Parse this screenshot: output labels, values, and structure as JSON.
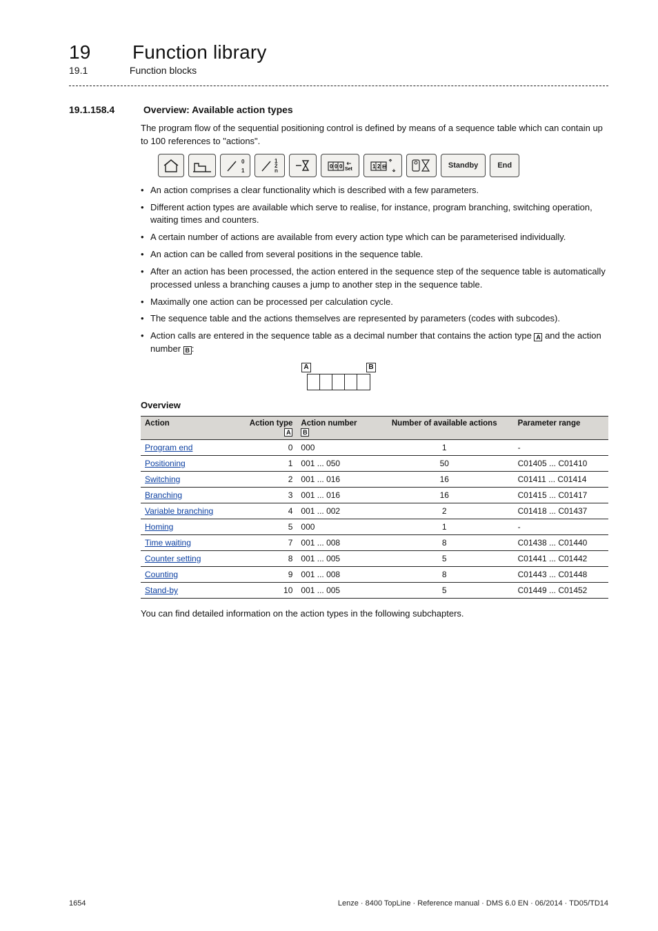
{
  "header": {
    "chapter_number": "19",
    "chapter_title": "Function library",
    "sub_number": "19.1",
    "sub_title": "Function blocks"
  },
  "section": {
    "number": "19.1.158.4",
    "title": "Overview: Available action types",
    "intro": "The program flow of the sequential positioning control is defined by means of a sequence table which can contain up to 100 references to \"actions\".",
    "iconbar_labels": {
      "standby": "Standby",
      "end": "End"
    },
    "bullets": [
      "An action comprises a clear functionality which is described with a few parameters.",
      "Different action types are available which serve to realise, for instance, program branching, switching operation, waiting times and counters.",
      "A certain number of actions are available from every action type which can be parameterised individually.",
      "An action can be called from several positions in the sequence table.",
      "After an action has been processed, the action entered in the sequence step of the sequence table is automatically processed unless a branching causes a jump to another step in the sequence table.",
      "Maximally one action can be processed per calculation cycle.",
      "The sequence table and the actions themselves are represented by parameters (codes with subcodes).",
      "Action calls are entered in the sequence table as a decimal number that contains the action type {A} and the action number {B}:"
    ],
    "ab_letters": {
      "a": "A",
      "b": "B"
    },
    "overview_label": "Overview",
    "table": {
      "headers": {
        "action": "Action",
        "type": "Action type",
        "type_sub": "A",
        "number": "Action number",
        "number_sub": "B",
        "available": "Number of available actions",
        "range": "Parameter range"
      },
      "rows": [
        {
          "action": "Program end",
          "type": "0",
          "number": "000",
          "avail": "1",
          "range": "-"
        },
        {
          "action": "Positioning",
          "type": "1",
          "number": "001 ... 050",
          "avail": "50",
          "range": "C01405 ... C01410"
        },
        {
          "action": "Switching",
          "type": "2",
          "number": "001 ... 016",
          "avail": "16",
          "range": "C01411 ... C01414"
        },
        {
          "action": "Branching",
          "type": "3",
          "number": "001 ... 016",
          "avail": "16",
          "range": "C01415 ... C01417"
        },
        {
          "action": "Variable branching",
          "type": "4",
          "number": "001 ... 002",
          "avail": "2",
          "range": "C01418 ... C01437"
        },
        {
          "action": "Homing",
          "type": "5",
          "number": "000",
          "avail": "1",
          "range": "-"
        },
        {
          "action": "Time waiting",
          "type": "7",
          "number": "001 ... 008",
          "avail": "8",
          "range": "C01438 ... C01440"
        },
        {
          "action": "Counter setting",
          "type": "8",
          "number": "001 ... 005",
          "avail": "5",
          "range": "C01441 ... C01442"
        },
        {
          "action": "Counting",
          "type": "9",
          "number": "001 ... 008",
          "avail": "8",
          "range": "C01443 ... C01448"
        },
        {
          "action": "Stand-by",
          "type": "10",
          "number": "001 ... 005",
          "avail": "5",
          "range": "C01449 ... C01452"
        }
      ]
    },
    "after_table": "You can find detailed information on the action types in the following subchapters."
  },
  "footer": {
    "page": "1654",
    "doc": "Lenze · 8400 TopLine · Reference manual · DMS 6.0 EN · 06/2014 · TD05/TD14"
  }
}
